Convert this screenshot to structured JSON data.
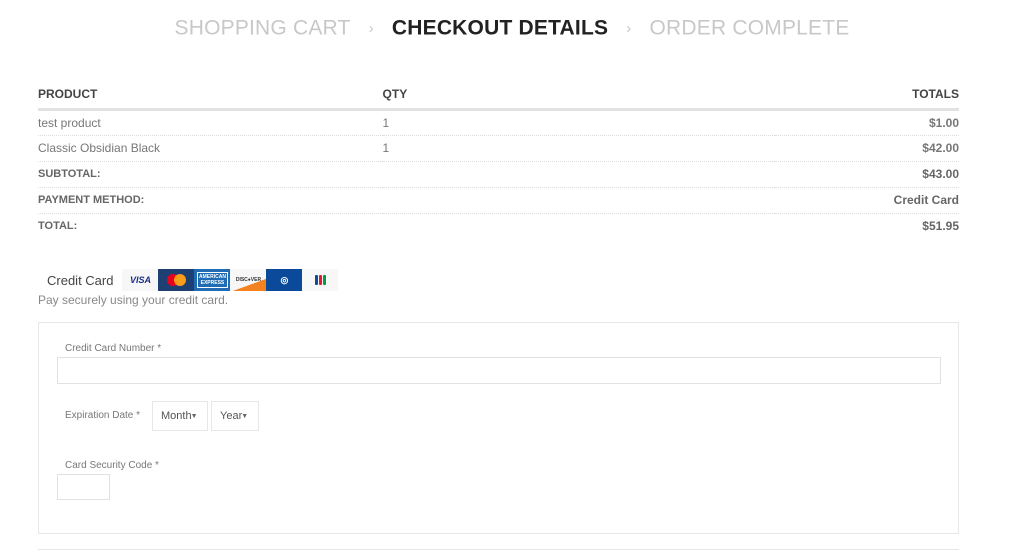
{
  "breadcrumb": {
    "steps": [
      {
        "label": "SHOPPING CART",
        "active": false
      },
      {
        "label": "CHECKOUT DETAILS",
        "active": true
      },
      {
        "label": "ORDER COMPLETE",
        "active": false
      }
    ],
    "separator": "›"
  },
  "order": {
    "headers": {
      "product": "PRODUCT",
      "qty": "QTY",
      "totals": "TOTALS"
    },
    "items": [
      {
        "product": "test product",
        "qty": "1",
        "total": "$1.00"
      },
      {
        "product": "Classic Obsidian Black",
        "qty": "1",
        "total": "$42.00"
      }
    ],
    "summary": [
      {
        "label": "SUBTOTAL:",
        "value": "$43.00"
      },
      {
        "label": "PAYMENT METHOD:",
        "value": "Credit Card"
      },
      {
        "label": "TOTAL:",
        "value": "$51.95"
      }
    ]
  },
  "payment": {
    "title": "Credit Card",
    "description": "Pay securely using your credit card.",
    "card_icons": [
      {
        "name": "visa-icon",
        "label": "VISA"
      },
      {
        "name": "mastercard-icon",
        "label": "MasterCard"
      },
      {
        "name": "amex-icon",
        "label": "AMERICAN EXPRESS"
      },
      {
        "name": "discover-icon",
        "label": "DISCOVER"
      },
      {
        "name": "diners-club-icon",
        "label": "Diners Club"
      },
      {
        "name": "jcb-icon",
        "label": "JCB"
      }
    ],
    "fields": {
      "card_number": {
        "label": "Credit Card Number",
        "required_mark": "*",
        "value": ""
      },
      "expiration": {
        "label": "Expiration Date",
        "required_mark": "*",
        "month": "Month",
        "year": "Year"
      },
      "security_code": {
        "label": "Card Security Code",
        "required_mark": "*",
        "value": ""
      }
    }
  }
}
